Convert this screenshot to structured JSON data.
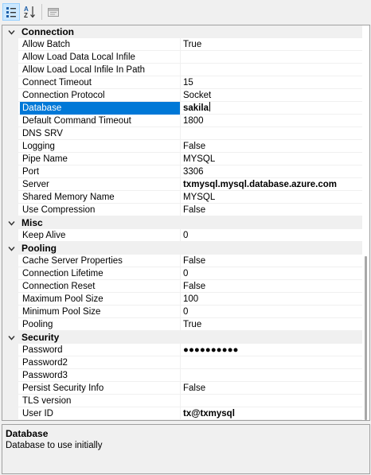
{
  "toolbar": {
    "buttons": [
      {
        "name": "categorized-view-button",
        "icon": "categorized-icon",
        "active": true
      },
      {
        "name": "alphabetical-view-button",
        "icon": "sort-az-icon",
        "active": false
      },
      {
        "name": "property-pages-button",
        "icon": "property-pages-icon",
        "active": false
      }
    ],
    "sort_icon_text": "A\nZ"
  },
  "grid": {
    "selected_property": "Database",
    "categories": [
      {
        "label": "Connection",
        "expanded": true,
        "properties": [
          {
            "name": "Allow Batch",
            "value": "True"
          },
          {
            "name": "Allow Load Data Local Infile",
            "value": ""
          },
          {
            "name": "Allow Load Local Infile In Path",
            "value": ""
          },
          {
            "name": "Connect Timeout",
            "value": "15"
          },
          {
            "name": "Connection Protocol",
            "value": "Socket"
          },
          {
            "name": "Database",
            "value": "sakila",
            "bold": true,
            "selected": true
          },
          {
            "name": "Default Command Timeout",
            "value": "1800"
          },
          {
            "name": "DNS SRV",
            "value": ""
          },
          {
            "name": "Logging",
            "value": "False"
          },
          {
            "name": "Pipe Name",
            "value": "MYSQL"
          },
          {
            "name": "Port",
            "value": "3306"
          },
          {
            "name": "Server",
            "value": "txmysql.mysql.database.azure.com",
            "bold": true
          },
          {
            "name": "Shared Memory Name",
            "value": "MYSQL"
          },
          {
            "name": "Use Compression",
            "value": "False"
          }
        ]
      },
      {
        "label": "Misc",
        "expanded": true,
        "properties": [
          {
            "name": "Keep Alive",
            "value": "0"
          }
        ]
      },
      {
        "label": "Pooling",
        "expanded": true,
        "properties": [
          {
            "name": "Cache Server Properties",
            "value": "False"
          },
          {
            "name": "Connection Lifetime",
            "value": "0"
          },
          {
            "name": "Connection Reset",
            "value": "False"
          },
          {
            "name": "Maximum Pool Size",
            "value": "100"
          },
          {
            "name": "Minimum Pool Size",
            "value": "0"
          },
          {
            "name": "Pooling",
            "value": "True"
          }
        ]
      },
      {
        "label": "Security",
        "expanded": true,
        "properties": [
          {
            "name": "Password",
            "value": "●●●●●●●●●●",
            "bold": true
          },
          {
            "name": "Password2",
            "value": ""
          },
          {
            "name": "Password3",
            "value": ""
          },
          {
            "name": "Persist Security Info",
            "value": "False"
          },
          {
            "name": "TLS version",
            "value": ""
          },
          {
            "name": "User ID",
            "value": "tx@txmysql",
            "bold": true
          }
        ]
      }
    ]
  },
  "description": {
    "title": "Database",
    "text": "Database to use initially"
  },
  "colors": {
    "selection": "#0078d7",
    "gutter": "#f0f0f0",
    "toolbar_active": "#cce8ff"
  }
}
